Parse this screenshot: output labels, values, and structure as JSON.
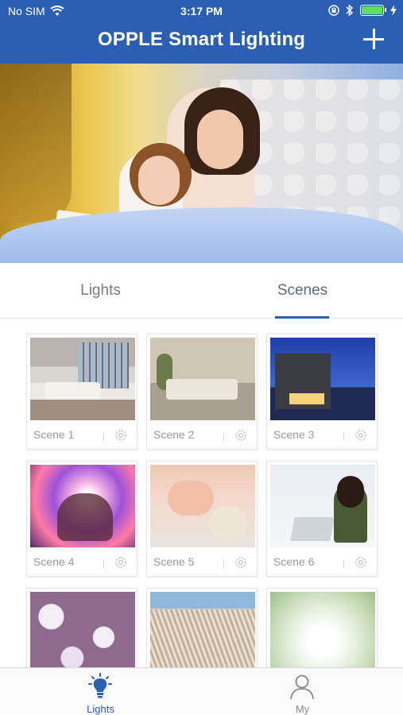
{
  "status_bar": {
    "carrier": "No SIM",
    "time": "3:17 PM",
    "battery_level": 0.95,
    "icons": [
      "wifi-icon",
      "orientation-lock-icon",
      "bluetooth-icon",
      "battery-icon",
      "charging-icon"
    ]
  },
  "nav": {
    "title": "OPPLE Smart Lighting",
    "add_icon": "plus-icon"
  },
  "segments": {
    "items": [
      {
        "label": "Lights",
        "selected": false
      },
      {
        "label": "Scenes",
        "selected": true
      }
    ]
  },
  "scenes": [
    {
      "label": "Scene 1"
    },
    {
      "label": "Scene 2"
    },
    {
      "label": "Scene 3"
    },
    {
      "label": "Scene 4"
    },
    {
      "label": "Scene 5"
    },
    {
      "label": "Scene 6"
    },
    {
      "label": ""
    },
    {
      "label": ""
    },
    {
      "label": ""
    }
  ],
  "tabbar": {
    "items": [
      {
        "label": "Lights",
        "icon": "lightbulb-icon",
        "selected": true
      },
      {
        "label": "My",
        "icon": "person-icon",
        "selected": false
      }
    ]
  },
  "colors": {
    "brand": "#2a5fb4",
    "tab_active": "#2a5fb4",
    "tab_inactive": "#8a8a8a"
  }
}
